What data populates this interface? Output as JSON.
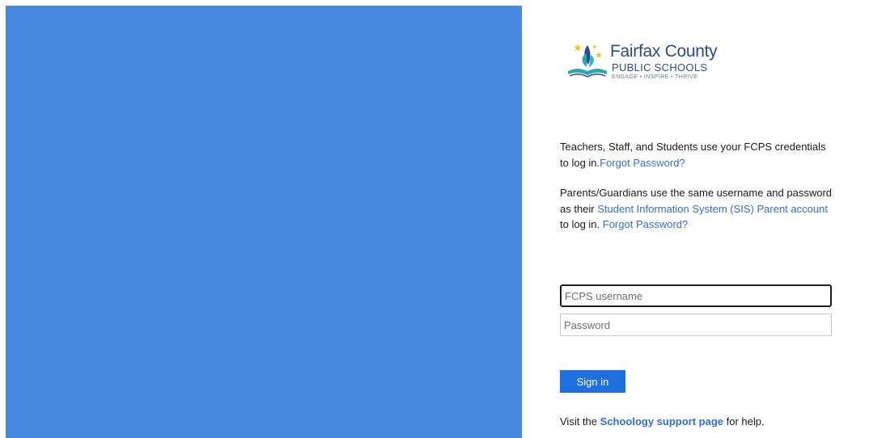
{
  "logo": {
    "line1": "Fairfax County",
    "line2": "PUBLIC SCHOOLS",
    "tagline": "ENGAGE • INSPIRE • THRIVE"
  },
  "intro": {
    "staff_text": "Teachers, Staff, and Students use your FCPS credentials to log in.",
    "staff_forgot_link": "Forgot Password?",
    "parent_text_1": "Parents/Guardians use the same username and password as their ",
    "sis_link": "Student Information System (SIS) Parent account",
    "parent_text_2": " to log in. ",
    "parent_forgot_link": "Forgot Password?"
  },
  "form": {
    "username_placeholder": "FCPS username",
    "password_placeholder": "Password",
    "signin_label": "Sign in"
  },
  "help": {
    "prefix": "Visit the ",
    "link": "Schoology support page",
    "suffix": " for help."
  },
  "colors": {
    "panel_blue": "#4688df",
    "link_blue": "#2f6fdc",
    "button_blue": "#1e6fe0"
  }
}
